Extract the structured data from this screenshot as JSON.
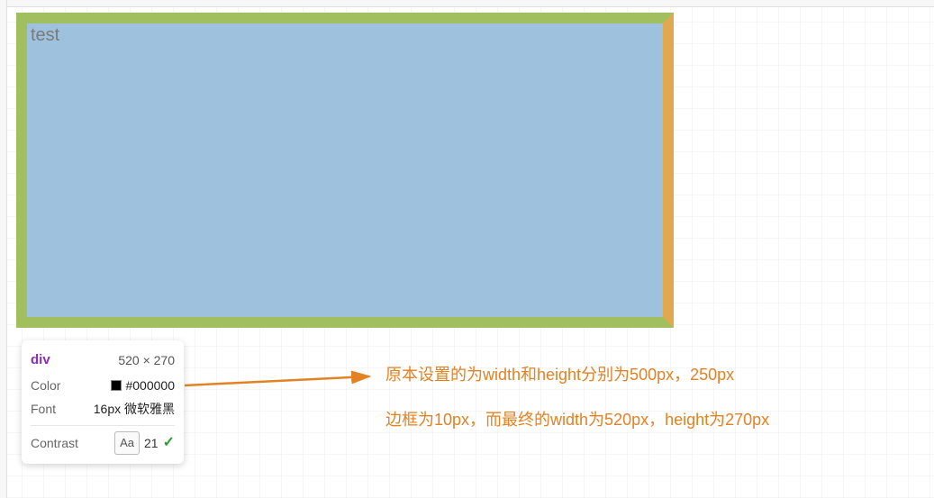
{
  "box": {
    "text": "test"
  },
  "tooltip": {
    "tag": "div",
    "dimensions": "520 × 270",
    "color_label": "Color",
    "color_value": "#000000",
    "font_label": "Font",
    "font_value": "16px 微软雅黑",
    "contrast_label": "Contrast",
    "contrast_aa": "Aa",
    "contrast_value": "21"
  },
  "annotation": {
    "line1": "原本设置的为width和height分别为500px，250px",
    "line2": "边框为10px，而最终的width为520px，height为270px"
  },
  "icons": {
    "check": "✓"
  }
}
